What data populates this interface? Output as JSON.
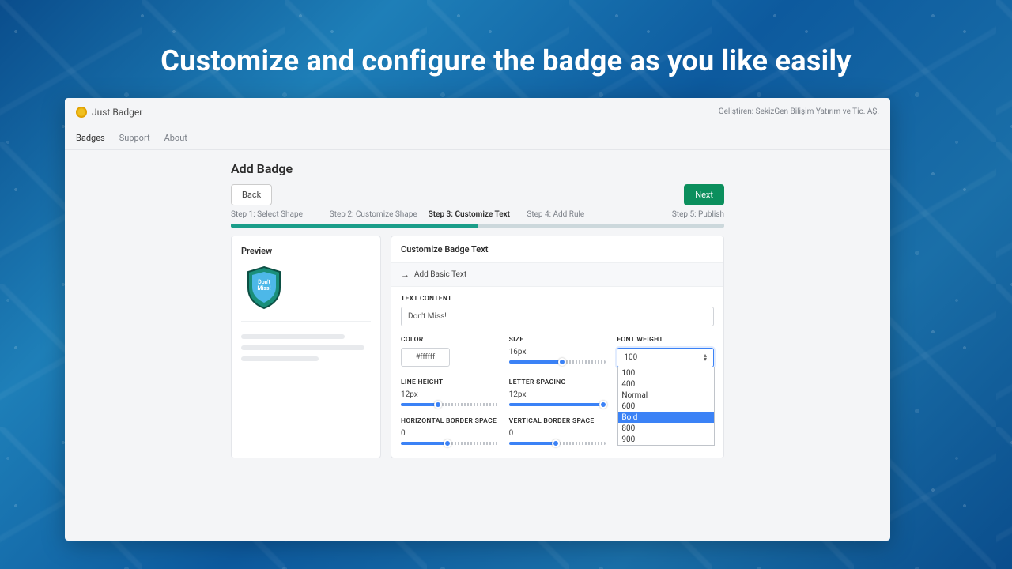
{
  "hero_title": "Customize and configure the badge as you like easily",
  "app": {
    "brand": "Just Badger",
    "developer": "Geliştiren: SekizGen Bilişim Yatırım ve Tic. AŞ."
  },
  "nav": {
    "badges": "Badges",
    "support": "Support",
    "about": "About"
  },
  "page": {
    "title": "Add Badge",
    "back": "Back",
    "next": "Next"
  },
  "steps": {
    "s1": "Step 1: Select Shape",
    "s2": "Step 2: Customize Shape",
    "s3": "Step 3: Customize Text",
    "s4": "Step 4: Add Rule",
    "s5": "Step 5: Publish"
  },
  "preview": {
    "title": "Preview",
    "badge_line1": "Don't",
    "badge_line2": "Miss!"
  },
  "customize": {
    "title": "Customize Badge Text",
    "add_basic": "Add Basic Text",
    "text_content_label": "TEXT CONTENT",
    "text_content_value": "Don't Miss!",
    "color_label": "COLOR",
    "color_value": "#ffffff",
    "size_label": "SIZE",
    "size_value": "16px",
    "font_weight_label": "FONT WEIGHT",
    "font_weight_value": "100",
    "line_height_label": "LINE HEIGHT",
    "line_height_value": "12px",
    "letter_spacing_label": "LETTER SPACING",
    "letter_spacing_value": "12px",
    "h_border_label": "HORIZONTAL BORDER SPACE",
    "h_border_value": "0",
    "v_border_label": "VERTICAL BORDER SPACE",
    "v_border_value": "0"
  },
  "font_weight_options": {
    "o1": "100",
    "o2": "400",
    "o3": "Normal",
    "o4": "600",
    "o5": "Bold",
    "o6": "800",
    "o7": "900"
  }
}
